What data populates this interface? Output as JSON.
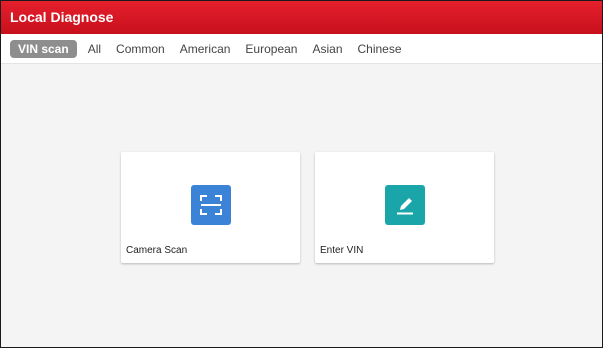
{
  "app": {
    "title": "Local Diagnose"
  },
  "tabs": [
    {
      "label": "VIN scan",
      "active": true
    },
    {
      "label": "All",
      "active": false
    },
    {
      "label": "Common",
      "active": false
    },
    {
      "label": "American",
      "active": false
    },
    {
      "label": "European",
      "active": false
    },
    {
      "label": "Asian",
      "active": false
    },
    {
      "label": "Chinese",
      "active": false
    }
  ],
  "cards": {
    "camera_scan": {
      "label": "Camera Scan",
      "icon": "scan-frame-icon",
      "icon_color": "#3b83d6"
    },
    "enter_vin": {
      "label": "Enter VIN",
      "icon": "pencil-icon",
      "icon_color": "#1aa6a8"
    }
  },
  "colors": {
    "header": "#d6151f",
    "active_tab": "#8e8e8e",
    "background": "#f4f4f4"
  }
}
